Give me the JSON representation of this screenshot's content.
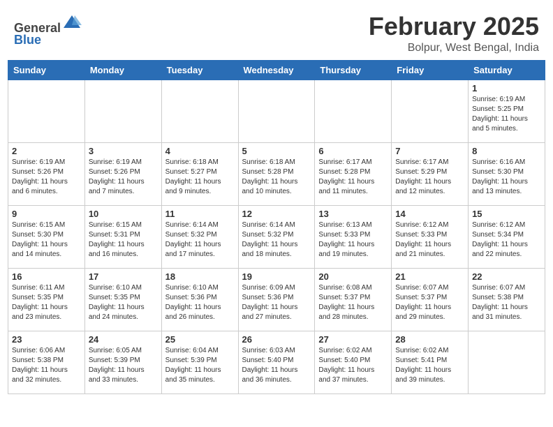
{
  "header": {
    "logo_general": "General",
    "logo_blue": "Blue",
    "title": "February 2025",
    "subtitle": "Bolpur, West Bengal, India"
  },
  "columns": [
    "Sunday",
    "Monday",
    "Tuesday",
    "Wednesday",
    "Thursday",
    "Friday",
    "Saturday"
  ],
  "weeks": [
    [
      {
        "day": "",
        "sunrise": "",
        "sunset": "",
        "daylight": ""
      },
      {
        "day": "",
        "sunrise": "",
        "sunset": "",
        "daylight": ""
      },
      {
        "day": "",
        "sunrise": "",
        "sunset": "",
        "daylight": ""
      },
      {
        "day": "",
        "sunrise": "",
        "sunset": "",
        "daylight": ""
      },
      {
        "day": "",
        "sunrise": "",
        "sunset": "",
        "daylight": ""
      },
      {
        "day": "",
        "sunrise": "",
        "sunset": "",
        "daylight": ""
      },
      {
        "day": "1",
        "sunrise": "Sunrise: 6:19 AM",
        "sunset": "Sunset: 5:25 PM",
        "daylight": "Daylight: 11 hours and 5 minutes."
      }
    ],
    [
      {
        "day": "2",
        "sunrise": "Sunrise: 6:19 AM",
        "sunset": "Sunset: 5:26 PM",
        "daylight": "Daylight: 11 hours and 6 minutes."
      },
      {
        "day": "3",
        "sunrise": "Sunrise: 6:19 AM",
        "sunset": "Sunset: 5:26 PM",
        "daylight": "Daylight: 11 hours and 7 minutes."
      },
      {
        "day": "4",
        "sunrise": "Sunrise: 6:18 AM",
        "sunset": "Sunset: 5:27 PM",
        "daylight": "Daylight: 11 hours and 9 minutes."
      },
      {
        "day": "5",
        "sunrise": "Sunrise: 6:18 AM",
        "sunset": "Sunset: 5:28 PM",
        "daylight": "Daylight: 11 hours and 10 minutes."
      },
      {
        "day": "6",
        "sunrise": "Sunrise: 6:17 AM",
        "sunset": "Sunset: 5:28 PM",
        "daylight": "Daylight: 11 hours and 11 minutes."
      },
      {
        "day": "7",
        "sunrise": "Sunrise: 6:17 AM",
        "sunset": "Sunset: 5:29 PM",
        "daylight": "Daylight: 11 hours and 12 minutes."
      },
      {
        "day": "8",
        "sunrise": "Sunrise: 6:16 AM",
        "sunset": "Sunset: 5:30 PM",
        "daylight": "Daylight: 11 hours and 13 minutes."
      }
    ],
    [
      {
        "day": "9",
        "sunrise": "Sunrise: 6:15 AM",
        "sunset": "Sunset: 5:30 PM",
        "daylight": "Daylight: 11 hours and 14 minutes."
      },
      {
        "day": "10",
        "sunrise": "Sunrise: 6:15 AM",
        "sunset": "Sunset: 5:31 PM",
        "daylight": "Daylight: 11 hours and 16 minutes."
      },
      {
        "day": "11",
        "sunrise": "Sunrise: 6:14 AM",
        "sunset": "Sunset: 5:32 PM",
        "daylight": "Daylight: 11 hours and 17 minutes."
      },
      {
        "day": "12",
        "sunrise": "Sunrise: 6:14 AM",
        "sunset": "Sunset: 5:32 PM",
        "daylight": "Daylight: 11 hours and 18 minutes."
      },
      {
        "day": "13",
        "sunrise": "Sunrise: 6:13 AM",
        "sunset": "Sunset: 5:33 PM",
        "daylight": "Daylight: 11 hours and 19 minutes."
      },
      {
        "day": "14",
        "sunrise": "Sunrise: 6:12 AM",
        "sunset": "Sunset: 5:33 PM",
        "daylight": "Daylight: 11 hours and 21 minutes."
      },
      {
        "day": "15",
        "sunrise": "Sunrise: 6:12 AM",
        "sunset": "Sunset: 5:34 PM",
        "daylight": "Daylight: 11 hours and 22 minutes."
      }
    ],
    [
      {
        "day": "16",
        "sunrise": "Sunrise: 6:11 AM",
        "sunset": "Sunset: 5:35 PM",
        "daylight": "Daylight: 11 hours and 23 minutes."
      },
      {
        "day": "17",
        "sunrise": "Sunrise: 6:10 AM",
        "sunset": "Sunset: 5:35 PM",
        "daylight": "Daylight: 11 hours and 24 minutes."
      },
      {
        "day": "18",
        "sunrise": "Sunrise: 6:10 AM",
        "sunset": "Sunset: 5:36 PM",
        "daylight": "Daylight: 11 hours and 26 minutes."
      },
      {
        "day": "19",
        "sunrise": "Sunrise: 6:09 AM",
        "sunset": "Sunset: 5:36 PM",
        "daylight": "Daylight: 11 hours and 27 minutes."
      },
      {
        "day": "20",
        "sunrise": "Sunrise: 6:08 AM",
        "sunset": "Sunset: 5:37 PM",
        "daylight": "Daylight: 11 hours and 28 minutes."
      },
      {
        "day": "21",
        "sunrise": "Sunrise: 6:07 AM",
        "sunset": "Sunset: 5:37 PM",
        "daylight": "Daylight: 11 hours and 29 minutes."
      },
      {
        "day": "22",
        "sunrise": "Sunrise: 6:07 AM",
        "sunset": "Sunset: 5:38 PM",
        "daylight": "Daylight: 11 hours and 31 minutes."
      }
    ],
    [
      {
        "day": "23",
        "sunrise": "Sunrise: 6:06 AM",
        "sunset": "Sunset: 5:38 PM",
        "daylight": "Daylight: 11 hours and 32 minutes."
      },
      {
        "day": "24",
        "sunrise": "Sunrise: 6:05 AM",
        "sunset": "Sunset: 5:39 PM",
        "daylight": "Daylight: 11 hours and 33 minutes."
      },
      {
        "day": "25",
        "sunrise": "Sunrise: 6:04 AM",
        "sunset": "Sunset: 5:39 PM",
        "daylight": "Daylight: 11 hours and 35 minutes."
      },
      {
        "day": "26",
        "sunrise": "Sunrise: 6:03 AM",
        "sunset": "Sunset: 5:40 PM",
        "daylight": "Daylight: 11 hours and 36 minutes."
      },
      {
        "day": "27",
        "sunrise": "Sunrise: 6:02 AM",
        "sunset": "Sunset: 5:40 PM",
        "daylight": "Daylight: 11 hours and 37 minutes."
      },
      {
        "day": "28",
        "sunrise": "Sunrise: 6:02 AM",
        "sunset": "Sunset: 5:41 PM",
        "daylight": "Daylight: 11 hours and 39 minutes."
      },
      {
        "day": "",
        "sunrise": "",
        "sunset": "",
        "daylight": ""
      }
    ]
  ]
}
